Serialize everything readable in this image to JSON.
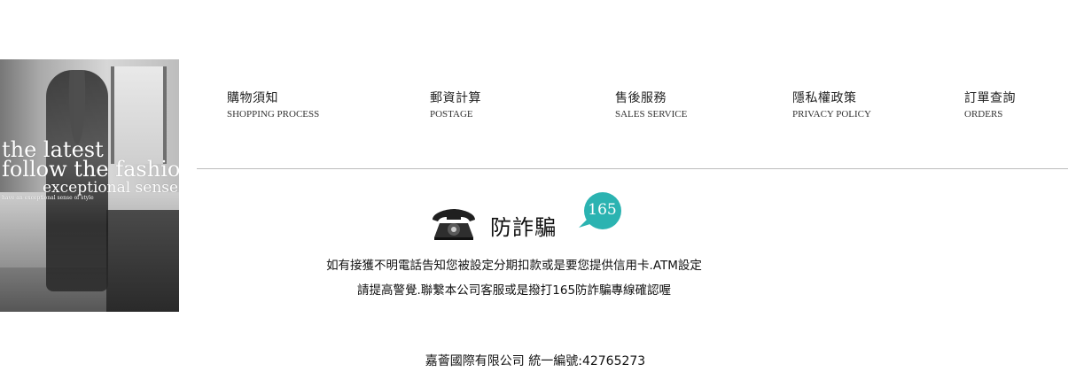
{
  "promo_image": {
    "overlay_lines": [
      "the latest",
      "follow the fashion",
      "exceptional sense",
      "have an exceptional sense of style"
    ]
  },
  "nav": {
    "items": [
      {
        "zh": "購物須知",
        "en": "SHOPPING PROCESS"
      },
      {
        "zh": "郵資計算",
        "en": "POSTAGE"
      },
      {
        "zh": "售後服務",
        "en": "SALES SERVICE"
      },
      {
        "zh": "隱私權政策",
        "en": "PRIVACY POLICY"
      },
      {
        "zh": "訂單查詢",
        "en": "ORDERS"
      }
    ]
  },
  "anti_fraud": {
    "title": "防詐騙",
    "badge_number": "165",
    "badge_color": "#2bb3b1",
    "icon": "telephone-icon",
    "message_line1": "如有接獲不明電話告知您被設定分期扣款或是要您提供信用卡.ATM設定",
    "message_line2": "請提高警覺.聯繫本公司客服或是撥打165防詐騙專線確認喔"
  },
  "footer": {
    "company": "嘉薈國際有限公司  統一編號:42765273"
  }
}
